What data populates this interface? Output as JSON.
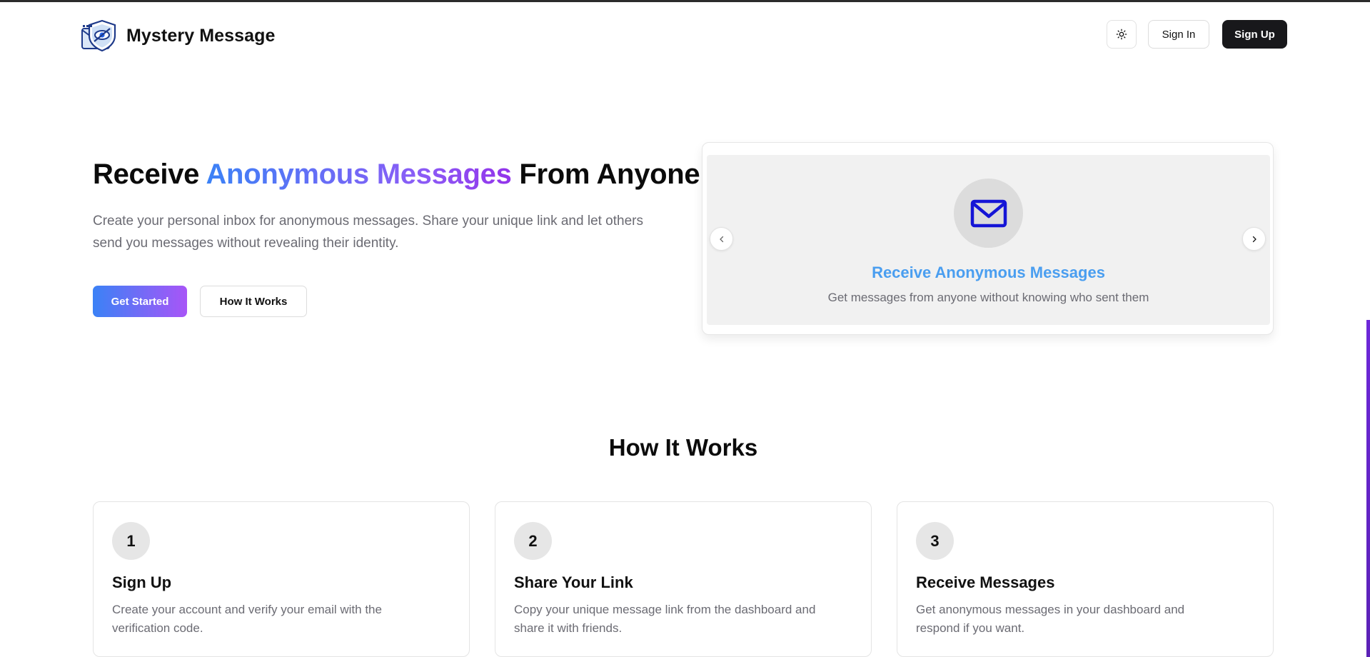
{
  "header": {
    "brand_name": "Mystery Message",
    "logo_icon": "shield-eye-logo-icon",
    "theme_icon": "sun-icon",
    "signin_label": "Sign In",
    "signup_label": "Sign Up"
  },
  "hero": {
    "title_prefix": "Receive ",
    "title_highlight": "Anonymous Messages",
    "title_suffix": " From Anyone",
    "subtitle": "Create your personal inbox for anonymous messages. Share your unique link and let others send you messages without revealing their identity.",
    "primary_button": "Get Started",
    "secondary_button": "How It Works"
  },
  "carousel": {
    "slide_icon": "mail-icon",
    "slide_title": "Receive Anonymous Messages",
    "slide_description": "Get messages from anyone without knowing who sent them",
    "prev_icon": "chevron-left-icon",
    "next_icon": "chevron-right-icon"
  },
  "how_it_works": {
    "title": "How It Works",
    "steps": [
      {
        "number": "1",
        "title": "Sign Up",
        "description": "Create your account and verify your email with the verification code."
      },
      {
        "number": "2",
        "title": "Share Your Link",
        "description": "Copy your unique message link from the dashboard and share it with friends."
      },
      {
        "number": "3",
        "title": "Receive Messages",
        "description": "Get anonymous messages in your dashboard and respond if you want."
      }
    ]
  },
  "colors": {
    "accent_blue": "#3b82f6",
    "accent_purple": "#a855f7",
    "dark_button": "#18181b",
    "slide_title": "#4a9ef0"
  }
}
